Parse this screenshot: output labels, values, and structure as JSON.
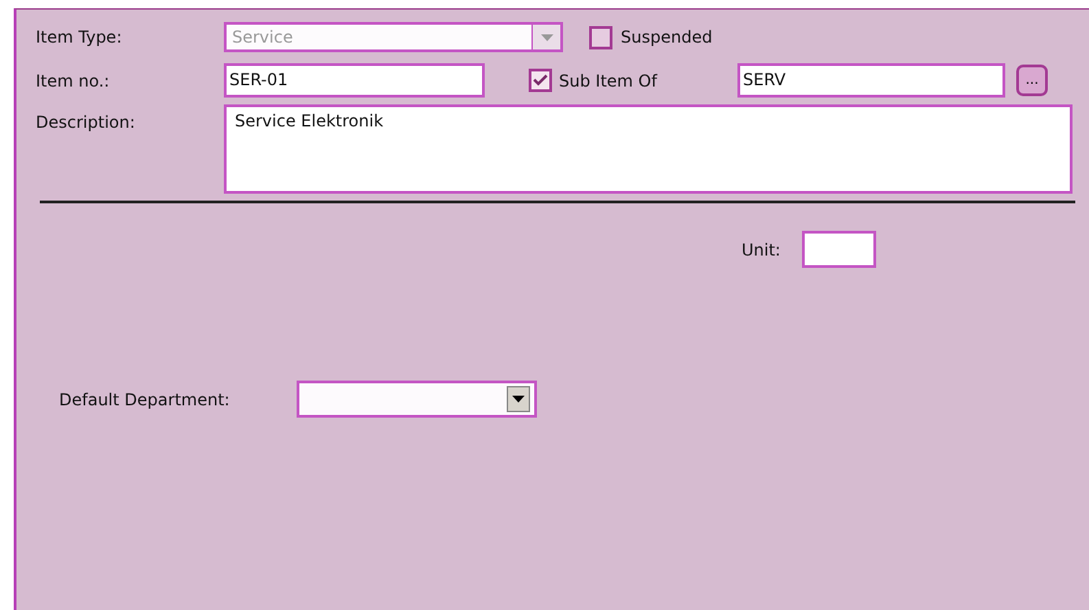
{
  "item_type": {
    "label": "Item Type:",
    "value": "Service",
    "disabled": true
  },
  "suspended": {
    "label": "Suspended",
    "checked": false
  },
  "item_no": {
    "label": "Item no.:",
    "value": "SER-01"
  },
  "sub_item_of": {
    "label": "Sub Item Of",
    "checked": true,
    "value": "SERV",
    "browse_button": "..."
  },
  "description": {
    "label": "Description:",
    "value": "Service Elektronik"
  },
  "unit": {
    "label": "Unit:"
  },
  "default_department": {
    "label": "Default Department:"
  }
}
